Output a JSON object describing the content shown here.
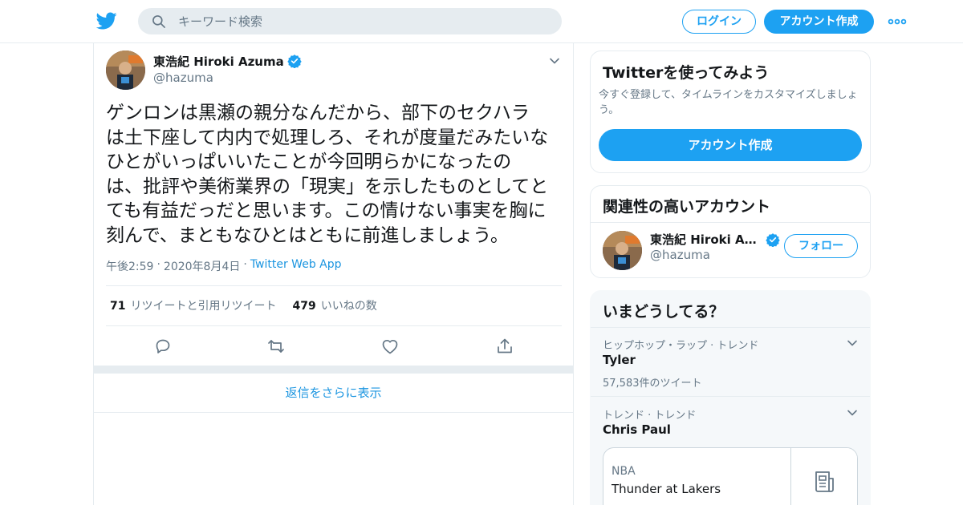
{
  "header": {
    "search_placeholder": "キーワード検索",
    "login_label": "ログイン",
    "signup_label": "アカウント作成"
  },
  "tweet": {
    "author_name": "東浩紀 Hiroki Azuma",
    "handle": "@hazuma",
    "verified": true,
    "text": "ゲンロンは黒瀬の親分なんだから、部下のセクハラ\nは土下座して内内で処理しろ、それが度量だみたいな\nひとがいっぱいいたことが今回明らかになったの\nは、批評や美術業界の「現実」を示したものとしてと\nても有益だっだと思います。この情けない事実を胸に\n刻んで、まともなひとはともに前進しましょう。",
    "time": "午後2:59",
    "date": "2020年8月4日",
    "separator": "·",
    "app": "Twitter Web App",
    "retweets_count": "71",
    "retweets_label": "リツイートと引用リツイート",
    "likes_count": "479",
    "likes_label": "いいねの数",
    "show_more_replies": "返信をさらに表示"
  },
  "sidebar": {
    "try_card": {
      "title": "Twitterを使ってみよう",
      "description": "今すぐ登録して、タイムラインをカスタマイズしましょう。",
      "button": "アカウント作成"
    },
    "related": {
      "title": "関連性の高いアカウント",
      "name": "東浩紀 Hiroki Azu...",
      "handle": "@hazuma",
      "follow_label": "フォロー"
    },
    "trends": {
      "title": "いまどうしてる？",
      "items": [
        {
          "context": "ヒップホップ・ラップ · トレンド",
          "name": "Tyler",
          "count": "57,583件のツイート"
        },
        {
          "context": "トレンド · トレンド",
          "name": "Chris Paul"
        }
      ],
      "news": {
        "category": "NBA",
        "title": "Thunder at Lakers"
      }
    }
  },
  "colors": {
    "accent": "#1da1f2",
    "link": "#1b95e0",
    "muted": "#657786",
    "border": "#e6ecf0"
  }
}
